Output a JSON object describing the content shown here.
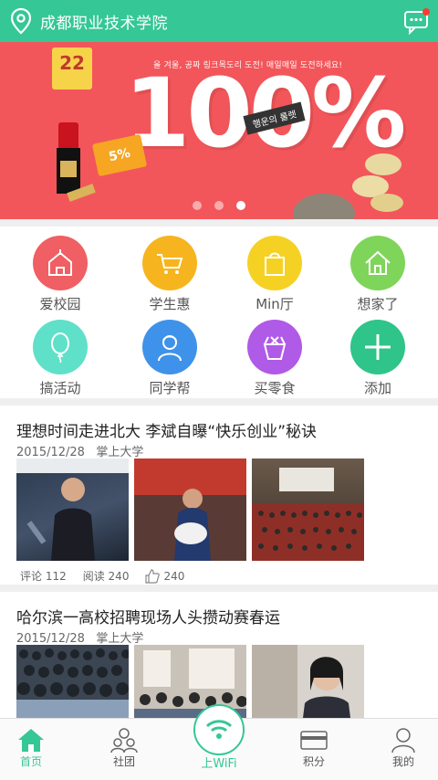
{
  "header": {
    "title": "成都职业技术学院"
  },
  "banner": {
    "tagline": "올 겨울, 공짜 링크목도리 도전! 매일매일 도전하세요!",
    "big_text": "100%",
    "ribbon_text": "행운의 룰렛",
    "tag_text": "5%",
    "badge_text": "22",
    "slides": 3,
    "active_slide": 2
  },
  "grid": {
    "items": [
      {
        "label": "爱校园",
        "icon": "school-icon",
        "color": "#ef5f63"
      },
      {
        "label": "学生惠",
        "icon": "cart-icon",
        "color": "#f6b51e"
      },
      {
        "label": "Min厅",
        "icon": "shopping-bag-icon",
        "color": "#f5d124"
      },
      {
        "label": "想家了",
        "icon": "home-icon",
        "color": "#7fd45a"
      },
      {
        "label": "搞活动",
        "icon": "balloon-icon",
        "color": "#5fe0c9"
      },
      {
        "label": "同学帮",
        "icon": "person-icon",
        "color": "#3f92ea"
      },
      {
        "label": "买零食",
        "icon": "snack-box-icon",
        "color": "#b05ae8"
      },
      {
        "label": "添加",
        "icon": "plus-icon",
        "color": "#2ec48a"
      }
    ]
  },
  "articles": [
    {
      "title": "理想时间走进北大 李斌自曝“快乐创业”秘诀",
      "date": "2015/12/28",
      "source": "掌上大学",
      "comments": "评论 112",
      "reads": "阅读 240",
      "likes": "240"
    },
    {
      "title": "哈尔滨一高校招聘现场人头攒动赛春运",
      "date": "2015/12/28",
      "source": "掌上大学"
    }
  ],
  "tabbar": {
    "items": [
      {
        "label": "首页",
        "icon": "home-icon"
      },
      {
        "label": "社团",
        "icon": "group-icon"
      },
      {
        "label": "上WiFi",
        "icon": "wifi-icon"
      },
      {
        "label": "积分",
        "icon": "card-icon"
      },
      {
        "label": "我的",
        "icon": "user-icon"
      }
    ],
    "active": "首页"
  },
  "colors": {
    "accent": "#35c796",
    "banner": "#f2565a"
  }
}
